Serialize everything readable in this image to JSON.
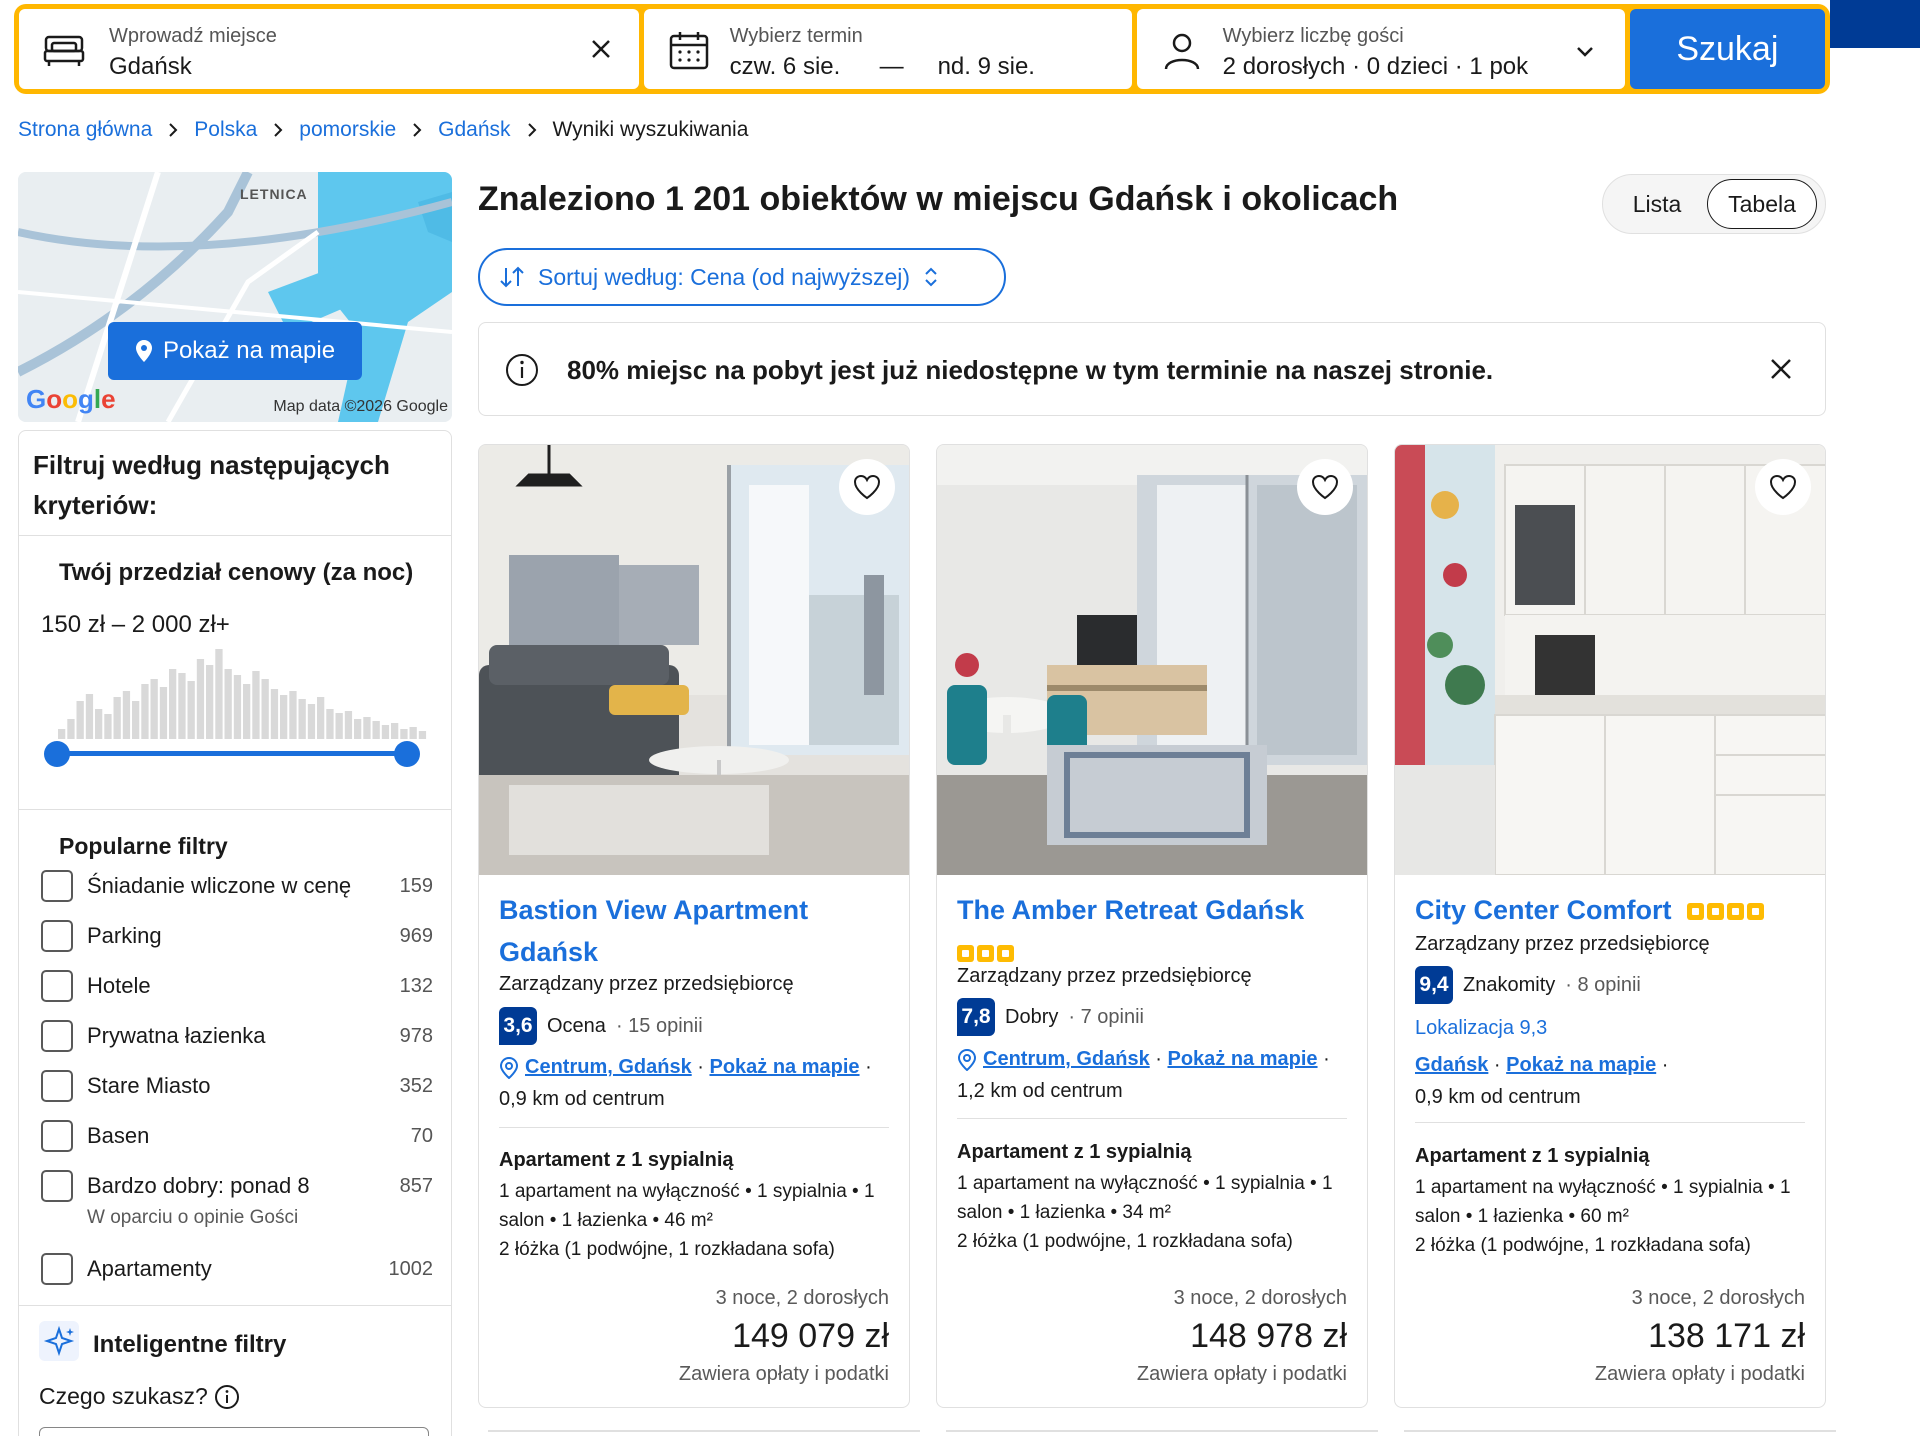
{
  "search": {
    "destination_label": "Wprowadź miejsce",
    "destination_value": "Gdańsk",
    "date_label": "Wybierz termin",
    "date_from": "czw. 6 sie.",
    "date_dash": "—",
    "date_to": "nd. 9 sie.",
    "guests_label": "Wybierz liczbę gości",
    "guests_value": "2 dorosłych · 0 dzieci · 1 pok",
    "search_button": "Szukaj"
  },
  "breadcrumb": {
    "items": [
      "Strona główna",
      "Polska",
      "pomorskie",
      "Gdańsk"
    ],
    "current": "Wyniki wyszukiwania"
  },
  "map": {
    "area_label": "LETNICA",
    "button": "Pokaż na mapie",
    "brand": "Google",
    "copyright": "Map data ©2026 Google"
  },
  "filters": {
    "title": "Filtruj według następujących kryteriów:",
    "price_title": "Twój przedział cenowy (za noc)",
    "price_range": "150 zł – 2 000 zł+",
    "popular_title": "Popularne filtry",
    "items": [
      {
        "label": "Śniadanie wliczone w cenę",
        "count": "159"
      },
      {
        "label": "Parking",
        "count": "969"
      },
      {
        "label": "Hotele",
        "count": "132"
      },
      {
        "label": "Prywatna łazienka",
        "count": "978"
      },
      {
        "label": "Stare Miasto",
        "count": "352"
      },
      {
        "label": "Basen",
        "count": "70"
      },
      {
        "label": "Bardzo dobry: ponad 8",
        "count": "857",
        "sub": "W oparciu o opinie Gości"
      },
      {
        "label": "Apartamenty",
        "count": "1002"
      }
    ],
    "smart_title": "Inteligentne filtry",
    "smart_question": "Czego szukasz?"
  },
  "results": {
    "title": "Znaleziono 1 201 obiektów w miejscu Gdańsk i okolicach",
    "view_list": "Lista",
    "view_table": "Tabela",
    "sort_label": "Sortuj według: Cena (od najwyższej)",
    "alert": "80% miejsc na pobyt jest już niedostępne w tym terminie na naszej stronie."
  },
  "cards": [
    {
      "title": "Bastion View Apartment Gdańsk",
      "stars": 0,
      "managed": "Zarządzany przez przedsiębiorcę",
      "score": "3,6",
      "score_word": "Ocena",
      "reviews": "· 15 opinii",
      "loc_link": "Centrum, Gdańsk",
      "map_link": "Pokaż na mapie",
      "distance": "0,9 km od centrum",
      "room_type": "Apartament z 1 sypialnią",
      "room_desc": "1 apartament na wyłączność • 1 sypialnia • 1 salon • 1 łazienka • 46 m²",
      "beds": "2 łóżka (1 podwójne, 1 rozkładana sofa)",
      "nights": "3 noce, 2 dorosłych",
      "price": "149 079 zł",
      "tax": "Zawiera opłaty i podatki"
    },
    {
      "title": "The Amber Retreat Gdańsk",
      "stars": 3,
      "managed": "Zarządzany przez przedsiębiorcę",
      "score": "7,8",
      "score_word": "Dobry",
      "reviews": "· 7 opinii",
      "loc_link": "Centrum, Gdańsk",
      "map_link": "Pokaż na mapie",
      "distance": "1,2 km od centrum",
      "room_type": "Apartament z 1 sypialnią",
      "room_desc": "1 apartament na wyłączność • 1 sypialnia • 1 salon • 1 łazienka • 34 m²",
      "beds": "2 łóżka (1 podwójne, 1 rozkładana sofa)",
      "nights": "3 noce, 2 dorosłych",
      "price": "148 978 zł",
      "tax": "Zawiera opłaty i podatki"
    },
    {
      "title": "City Center Comfort",
      "stars": 4,
      "managed": "Zarządzany przez przedsiębiorcę",
      "score": "9,4",
      "score_word": "Znakomity",
      "reviews": "· 8 opinii",
      "location_score": "Lokalizacja 9,3",
      "loc_link": "Gdańsk",
      "map_link": "Pokaż na mapie",
      "distance": "0,9 km od centrum",
      "room_type": "Apartament z 1 sypialnią",
      "room_desc": "1 apartament na wyłączność • 1 sypialnia • 1 salon • 1 łazienka • 60 m²",
      "beds": "2 łóżka (1 podwójne, 1 rozkładana sofa)",
      "nights": "3 noce, 2 dorosłych",
      "price": "138 171 zł",
      "tax": "Zawiera opłaty i podatki"
    }
  ],
  "colors": {
    "brand_blue": "#1a6fdb",
    "dark_blue": "#003b95",
    "search_border": "#ffb700",
    "star": "#febb02"
  }
}
